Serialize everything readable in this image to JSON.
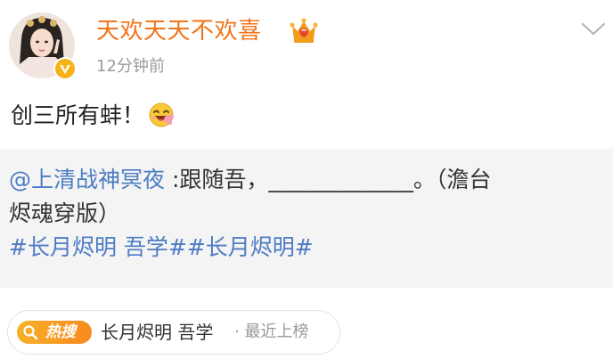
{
  "post": {
    "author": {
      "name": "天欢天天不欢喜",
      "avatar_icon": "avatar-photo",
      "verified_icon": "verified-badge-icon",
      "vip_icon": "vip-crown-icon"
    },
    "time": "12分钟前",
    "more_icon": "chevron-down-icon",
    "text": "创三所有蚌！",
    "emoji_icon": "laughing-emoji-icon"
  },
  "repost": {
    "mention": "@上清战神冥夜",
    "text_line1": " :跟随吾，_____________。（澹台",
    "text_line2": "烬魂穿版）",
    "tag1": "#长月烬明 吾学#",
    "tag2": "#长月烬明#"
  },
  "hot_search": {
    "badge": "热搜",
    "topic": "长月烬明 吾学",
    "meta": "· 最近上榜"
  },
  "colors": {
    "username": "#f2741a",
    "link": "#4d7cc5",
    "repost_bg": "#f4f4f4",
    "hot_badge": "#f7a025"
  }
}
